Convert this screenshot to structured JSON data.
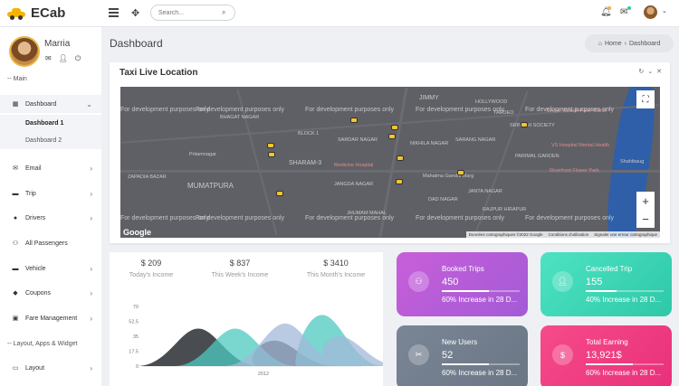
{
  "app": {
    "name": "ECab"
  },
  "header": {
    "search_placeholder": "Search...",
    "icons": [
      "hamburger-icon",
      "expand-icon",
      "search-icon",
      "bell-icon",
      "mail-icon"
    ]
  },
  "profile": {
    "name": "Marria",
    "icons": [
      "mail-icon",
      "user-icon",
      "power-icon"
    ]
  },
  "sidebar": {
    "main_label": "-- Main",
    "dashboard": {
      "label": "Dashboard",
      "subitems": [
        "Dashboard 1",
        "Dashboard 2"
      ]
    },
    "items": [
      {
        "label": "Email",
        "icon": "envelope-icon"
      },
      {
        "label": "Trip",
        "icon": "car-icon"
      },
      {
        "label": "Drivers",
        "icon": "driver-icon"
      },
      {
        "label": "All Passengers",
        "icon": "users-icon"
      },
      {
        "label": "Vehicle",
        "icon": "vehicle-icon"
      },
      {
        "label": "Coupons",
        "icon": "coupon-icon"
      },
      {
        "label": "Fare Management",
        "icon": "fare-icon"
      }
    ],
    "layout_label": "-- Layout, Apps & Widget",
    "layout_item": {
      "label": "Layout",
      "icon": "monitor-icon"
    }
  },
  "page": {
    "title": "Dashboard"
  },
  "breadcrumb": {
    "home": "Home",
    "current": "Dashboard"
  },
  "map_card": {
    "title": "Taxi Live Location",
    "watermark": "For development purposes only",
    "google": "Google",
    "attribution": [
      "Données cartographiques ©2022 Google",
      "Conditions d'utilisation",
      "Signaler une erreur cartographique"
    ],
    "zoom_in": "+",
    "zoom_out": "−",
    "places": [
      "JIMMY",
      "HOLLYWOOD",
      "TARDEO",
      "BLOCK 1",
      "SHARAM-3",
      "MUMATPURA",
      "ZAPADIA BAZAR",
      "JANGDA NAGAR",
      "DAD NAGAR",
      "JANTA NAGAR",
      "Medicine Hospital",
      "PARIMAL GARDEN",
      "Sardar Vallabh Patel Statue",
      "VS Hospital Mental Health",
      "Riverfront Flower Park",
      "Pritamnagar",
      "SARDAR NAGAR",
      "BHAGAT NAGAR",
      "NIKHILA NAGAR",
      "SARANG NAGAR",
      "RAJPUR HIRAPUR",
      "Shahibaug",
      "Mahatma Gandhi Marg",
      "SRINIDHI SOCIETY",
      "JHUMAM MAHAL"
    ]
  },
  "income": [
    {
      "value": "$ 209",
      "label": "Today's Income"
    },
    {
      "value": "$ 837",
      "label": "This Week's Income"
    },
    {
      "value": "$ 3410",
      "label": "This Month's Income"
    }
  ],
  "chart_data": {
    "type": "area",
    "x_label": "2012",
    "ylim": [
      0,
      70
    ],
    "y_ticks": [
      "0",
      "17.5",
      "35",
      "52.5",
      "70"
    ],
    "series": [
      {
        "color": "#3f4348",
        "peaks": [
          [
            0.25,
            44
          ],
          [
            0.6,
            30
          ]
        ]
      },
      {
        "color": "#4dc9c0",
        "peaks": [
          [
            0.42,
            44
          ],
          [
            0.82,
            60
          ]
        ]
      },
      {
        "color": "#a3b8d8",
        "peaks": [
          [
            0.65,
            50
          ],
          [
            0.9,
            35
          ]
        ]
      }
    ]
  },
  "stats": [
    {
      "title": "Booked Trips",
      "value": "450",
      "desc": "60% Increase in 28 D...",
      "progress": 0.6,
      "icon": "group-icon",
      "colors": [
        "#c85ed9",
        "#a35bd6"
      ]
    },
    {
      "title": "Cancelled Trip",
      "value": "155",
      "desc": "40% Increase in 28 D...",
      "progress": 0.4,
      "icon": "user-icon",
      "colors": [
        "#4de3c2",
        "#2ec8a8"
      ]
    },
    {
      "title": "New Users",
      "value": "52",
      "desc": "60% Increase in 28 D...",
      "progress": 0.6,
      "icon": "scissors-icon",
      "colors": [
        "#7a8696",
        "#6a7684"
      ]
    },
    {
      "title": "Total Earning",
      "value": "13,921$",
      "desc": "60% Increase in 28 D...",
      "progress": 0.6,
      "icon": "dollar-icon",
      "colors": [
        "#f64b8a",
        "#e8307a"
      ]
    }
  ]
}
